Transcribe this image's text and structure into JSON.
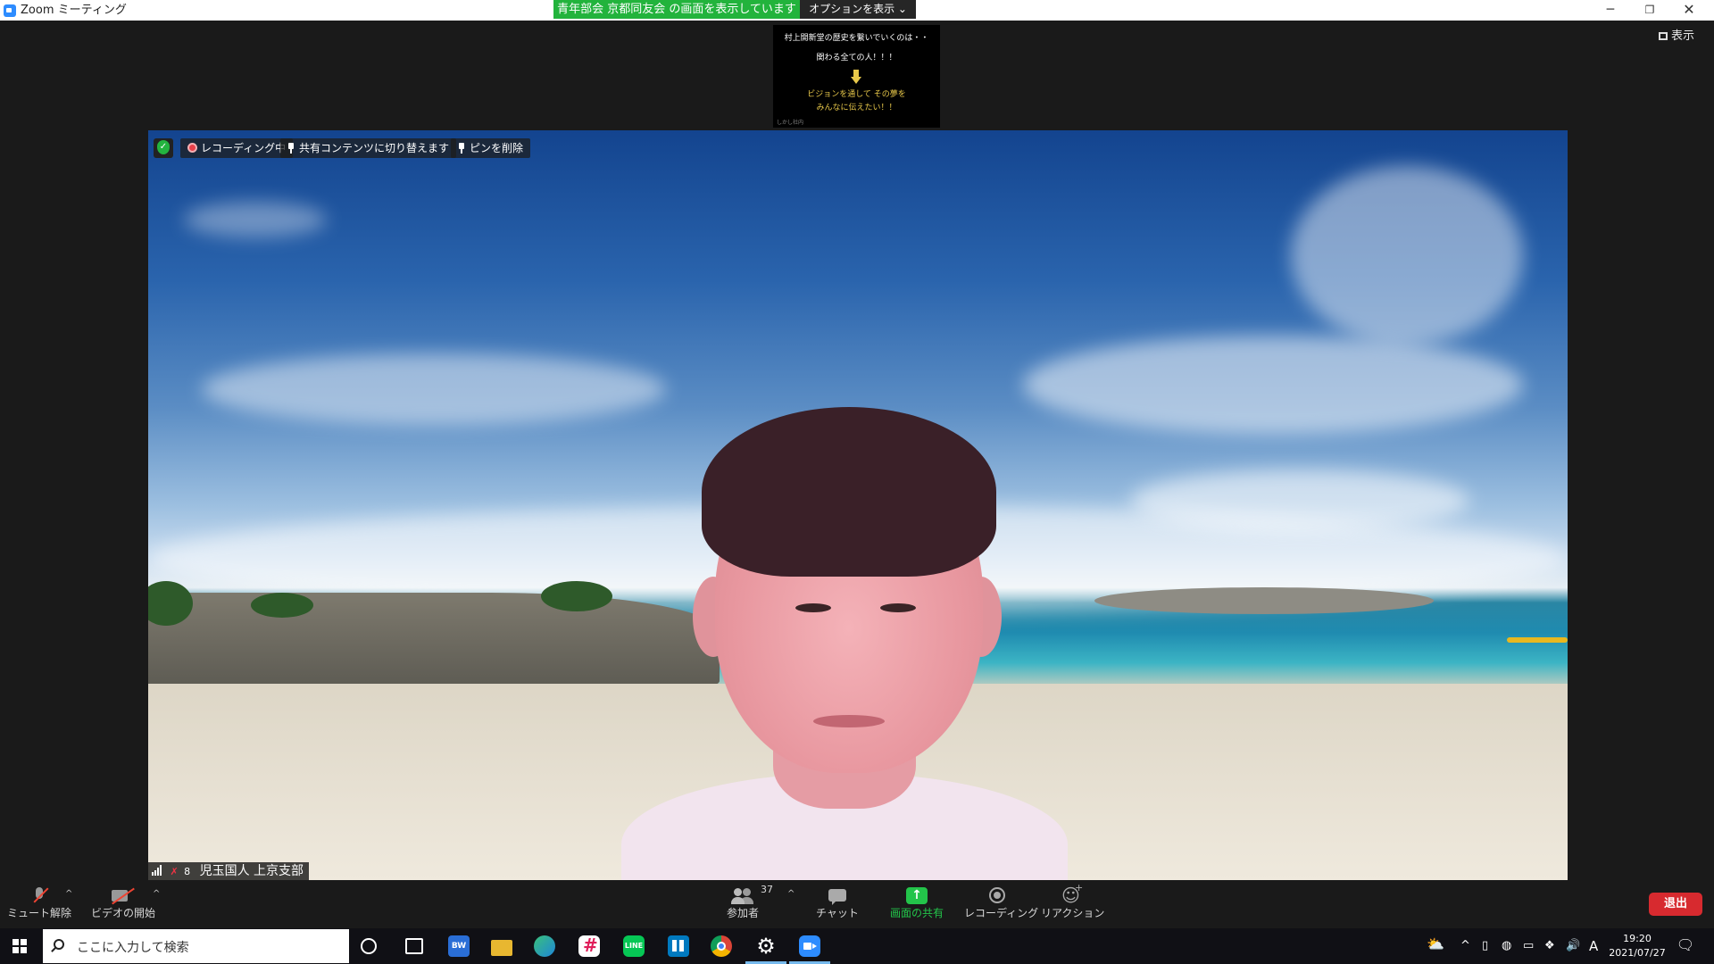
{
  "window": {
    "title": "Zoom ミーティング",
    "share_banner": "青年部会 京都同友会 の画面を表示しています",
    "options_label": "オプションを表示 ⌄",
    "view_label": "表示",
    "minimize": "─",
    "restore": "❐",
    "close": "✕"
  },
  "shared_preview": {
    "line1": "村上開新堂の歴史を繋いでいくのは・・",
    "line2": "関わる全ての人！！！",
    "line3": "ビジョンを通して その夢を",
    "line4": "みんなに伝えたい！！",
    "footer": "しかし社内"
  },
  "video": {
    "recording_label": "レコーディング中",
    "switch_label": "共有コンテンツに切り替えます",
    "unpin_label": "ピンを削除",
    "mic_glyph": "✗",
    "participant_number": "8",
    "participant_name": "児玉国人 上京支部"
  },
  "controls": {
    "unmute": "ミュート解除",
    "start_video": "ビデオの開始",
    "participants": "参加者",
    "participant_count": "37",
    "chat": "チャット",
    "share_screen": "画面の共有",
    "recording": "レコーディング",
    "reactions": "リアクション",
    "leave": "退出",
    "caret": "^"
  },
  "taskbar": {
    "search_placeholder": "ここに入力して検索",
    "app1_label": "BW",
    "line_label": "LINE",
    "gear": "⚙",
    "time": "19:20",
    "date": "2021/07/27",
    "ime": "A",
    "notification": "🗨",
    "tray_chevron": "^",
    "volume": "🔊"
  },
  "colors": {
    "share_green": "#22b33c",
    "leave_red": "#d72a2f",
    "zoom_blue": "#2d8cff"
  }
}
